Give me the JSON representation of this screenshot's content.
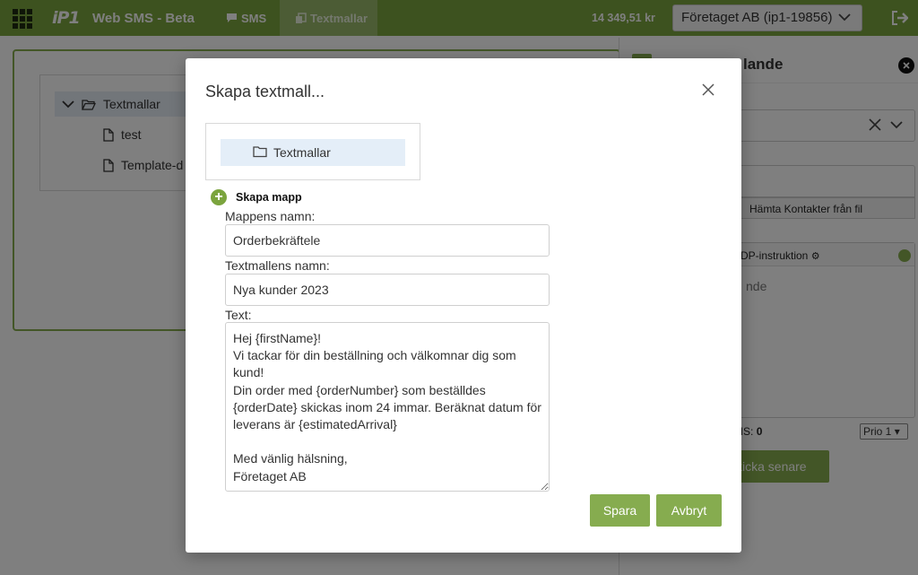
{
  "topbar": {
    "logo_text": "iP1",
    "app_name": "Web SMS - Beta",
    "nav": [
      {
        "label": "SMS",
        "icon": "chat-icon"
      },
      {
        "label": "Textmallar",
        "icon": "copy-icon"
      }
    ],
    "balance": "14 349,51 kr",
    "company": "Företaget AB (ip1-19856)",
    "brand_color": "#7ba43e"
  },
  "tree": {
    "root_label": "Textmallar",
    "items": [
      "test",
      "Template-d"
    ]
  },
  "right_panel": {
    "title": "lande",
    "fetch_contacts": "Hämta Kontakter från fil",
    "msg_header": "DP-instruktion",
    "msg_placeholder": "nde",
    "sms_count_label": "MS:",
    "sms_count_value": "0",
    "prio": "Prio 1",
    "send_later": "kicka senare"
  },
  "modal": {
    "title": "Skapa textmall...",
    "folder": "Textmallar",
    "create_folder": "Skapa mapp",
    "folder_name_label": "Mappens namn:",
    "folder_name_value": "Orderbekräftele",
    "template_name_label": "Textmallens namn:",
    "template_name_value": "Nya kunder 2023",
    "text_label": "Text:",
    "text_value": "Hej {firstName}!\nVi tackar för din beställning och välkomnar dig som kund!\nDin order med {orderNumber} som beställdes {orderDate} skickas inom 24 immar. Beräknat datum för leverans är {estimatedArrival}\n\nMed vänlig hälsning,\nFöretaget AB",
    "save": "Spara",
    "cancel": "Avbryt"
  }
}
